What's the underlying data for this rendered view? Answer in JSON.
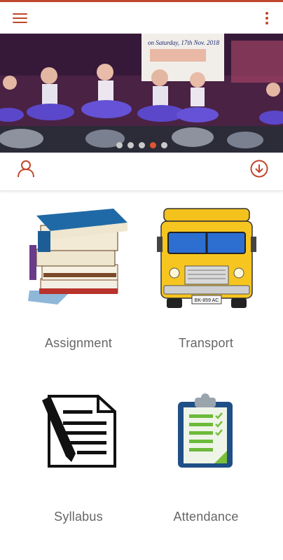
{
  "colors": {
    "accent": "#c0472c",
    "dot_active": "#e0552f",
    "dot_inactive": "#c9c9c9",
    "label": "#666666"
  },
  "banner": {
    "text_lines": [
      "on Saturday, 17th Nov. 2018"
    ],
    "carousel": {
      "page_count": 5,
      "active_index": 3
    }
  },
  "actions": {
    "icons": [
      "user-icon",
      "download-circle-icon"
    ]
  },
  "tiles": [
    {
      "label": "Assignment",
      "icon": "books-icon"
    },
    {
      "label": "Transport",
      "icon": "school-bus-icon",
      "plate": "BK-859 AC"
    },
    {
      "label": "Syllabus",
      "icon": "document-pen-icon"
    },
    {
      "label": "Attendance",
      "icon": "clipboard-checklist-icon"
    }
  ]
}
